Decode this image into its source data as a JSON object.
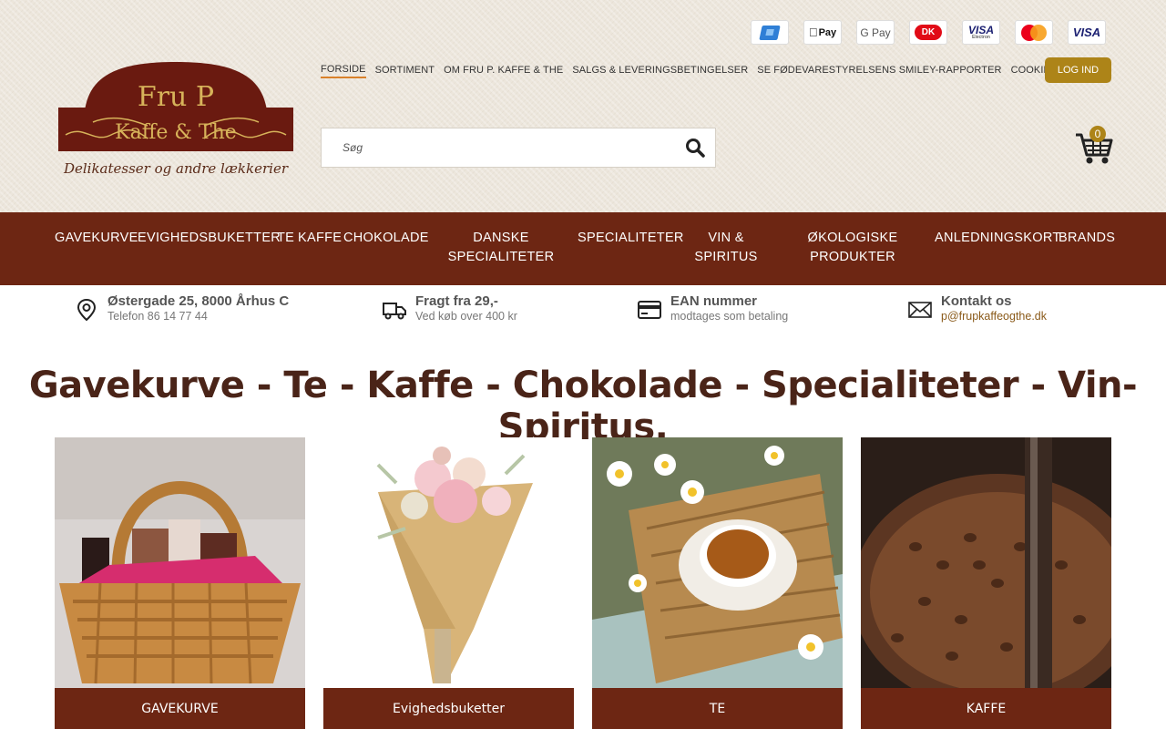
{
  "brand": {
    "logo_line1": "Fru P",
    "logo_line2": "Kaffe & The",
    "tagline": "Delikatesser og andre lækkerier"
  },
  "payment_methods": [
    {
      "name": "mobilepay-icon"
    },
    {
      "name": "applepay-icon",
      "label": "Pay"
    },
    {
      "name": "googlepay-icon",
      "label": "G Pay"
    },
    {
      "name": "dankort-icon",
      "label": "DK"
    },
    {
      "name": "visa-electron-icon",
      "label": "VISA",
      "sub": "Electron"
    },
    {
      "name": "mastercard-icon"
    },
    {
      "name": "visa-icon",
      "label": "VISA"
    }
  ],
  "top_nav": [
    {
      "label": "Forside",
      "active": true
    },
    {
      "label": "Sortiment"
    },
    {
      "label": "Om Fru P. Kaffe & The"
    },
    {
      "label": "Salgs & leveringsbetingelser"
    },
    {
      "label": "Se Fødevarestyrelsens smiley-rapporter"
    },
    {
      "label": "Cookies"
    }
  ],
  "login_label": "LOG IND",
  "search": {
    "placeholder": "Søg"
  },
  "cart": {
    "count": "0"
  },
  "main_nav": [
    {
      "label": "Gavekurve"
    },
    {
      "label": "Evighedsbuketter"
    },
    {
      "label": "Te"
    },
    {
      "label": "Kaffe"
    },
    {
      "label": "Chokolade"
    },
    {
      "label": "Danske specialiteter"
    },
    {
      "label": "Specialiteter"
    },
    {
      "label": "Vin & spiritus"
    },
    {
      "label": "Økologiske produkter"
    },
    {
      "label": "Anledningskort"
    },
    {
      "label": "Brands"
    }
  ],
  "info": [
    {
      "title": "Østergade 25, 8000 Århus C",
      "sub": "Telefon 86 14 77 44"
    },
    {
      "title": "Fragt fra 29,-",
      "sub": "Ved køb over 400 kr"
    },
    {
      "title": "EAN nummer",
      "sub": "modtages som betaling"
    },
    {
      "title": "Kontakt os",
      "sub": "p@frupkaffeogthe.dk"
    }
  ],
  "headline": "Gavekurve - Te - Kaffe - Chokolade - Specialiteter - Vin- Spiritus.",
  "categories": [
    {
      "label": "GAVEKURVE"
    },
    {
      "label": "Evighedsbuketter"
    },
    {
      "label": "TE"
    },
    {
      "label": "KAFFE"
    }
  ],
  "colors": {
    "nav_bg": "#6d2613",
    "accent": "#ad8418",
    "headline": "#4a2418"
  }
}
